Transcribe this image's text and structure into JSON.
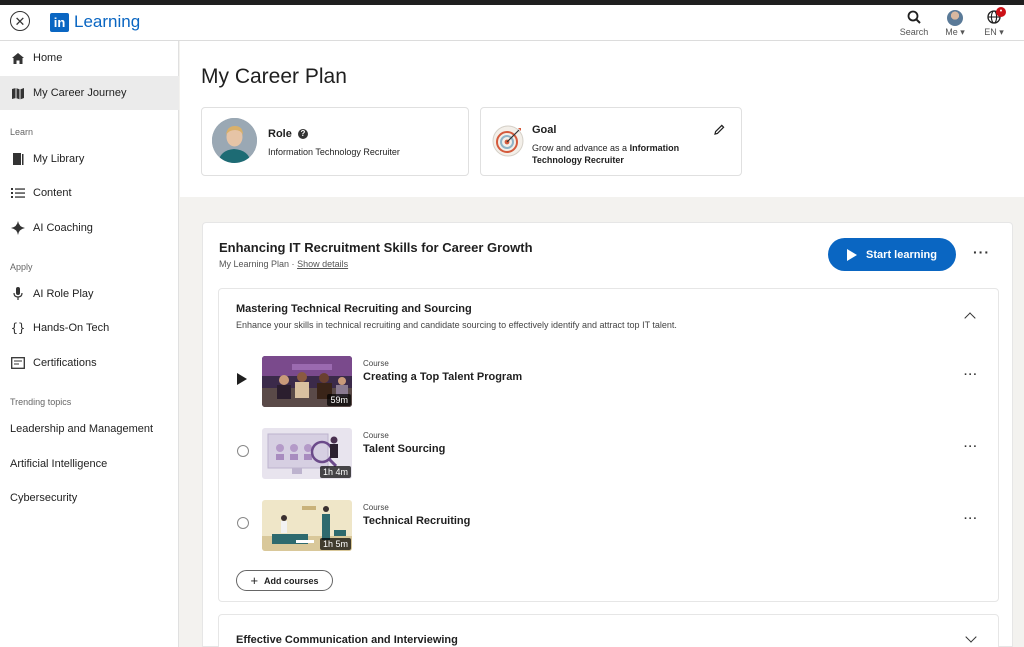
{
  "header": {
    "logo_mark": "in",
    "logo_text": "Learning",
    "search_label": "Search",
    "me_label": "Me",
    "language_label": "EN",
    "notification_badge": "•",
    "accent": "#0a66c2"
  },
  "sidebar": {
    "items": [
      {
        "label": "Home",
        "icon": "home-icon"
      },
      {
        "label": "My Career Journey",
        "icon": "map-icon"
      }
    ],
    "sections": {
      "learn": "Learn",
      "apply": "Apply",
      "trending": "Trending topics"
    },
    "learn_items": [
      {
        "label": "My Library",
        "icon": "library-icon"
      },
      {
        "label": "Content",
        "icon": "list-icon"
      },
      {
        "label": "AI Coaching",
        "icon": "sparkle-icon"
      }
    ],
    "apply_items": [
      {
        "label": "AI Role Play",
        "icon": "microphone-icon"
      },
      {
        "label": "Hands-On Tech",
        "icon": "code-braces-icon"
      },
      {
        "label": "Certifications",
        "icon": "certificate-icon"
      }
    ],
    "topics": [
      "Leadership and Management",
      "Artificial Intelligence",
      "Cybersecurity"
    ]
  },
  "main": {
    "page_title": "My Career Plan",
    "role": {
      "title": "Role",
      "value": "Information Technology Recruiter"
    },
    "goal": {
      "title": "Goal",
      "prefix": "Grow and advance as a",
      "value_part1": "Information",
      "value_part2": "Technology Recruiter"
    }
  },
  "plan": {
    "title": "Enhancing IT Recruitment Skills for Career Growth",
    "subtitle": "My Learning Plan ·",
    "details_link": "Show details",
    "start_label": "Start learning",
    "more": "···",
    "sections": [
      {
        "title": "Mastering Technical Recruiting and Sourcing",
        "description": "Enhance your skills in technical recruiting and candidate sourcing to effectively identify and attract top IT talent.",
        "courses": [
          {
            "type": "Course",
            "name": "Creating a Top Talent Program",
            "duration": "59m"
          },
          {
            "type": "Course",
            "name": "Talent Sourcing",
            "duration": "1h 4m"
          },
          {
            "type": "Course",
            "name": "Technical Recruiting",
            "duration": "1h 5m"
          }
        ],
        "add_label": "Add courses"
      },
      {
        "title": "Effective Communication and Interviewing"
      }
    ]
  }
}
